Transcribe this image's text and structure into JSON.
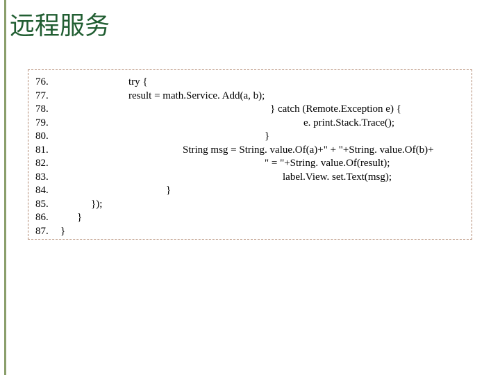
{
  "title": "远程服务",
  "code": {
    "lines": [
      {
        "n": "76.",
        "text": "try {"
      },
      {
        "n": "77.",
        "text": "result = math.Service. Add(a, b);"
      },
      {
        "n": "78.",
        "text": "} catch (Remote.Exception e) {"
      },
      {
        "n": "79.",
        "text": "e. print.Stack.Trace();"
      },
      {
        "n": "80.",
        "text": "}"
      },
      {
        "n": "81.",
        "text": "String msg = String. value.Of(a)+\" + \"+String. value.Of(b)+"
      },
      {
        "n": "82.",
        "text": "\" = \"+String. value.Of(result);"
      },
      {
        "n": "83.",
        "text": "label.View. set.Text(msg);"
      },
      {
        "n": "84.",
        "text": "}"
      },
      {
        "n": "85.",
        "text": "});"
      },
      {
        "n": "86.",
        "text": "}"
      },
      {
        "n": "87.",
        "text": "}"
      }
    ]
  }
}
